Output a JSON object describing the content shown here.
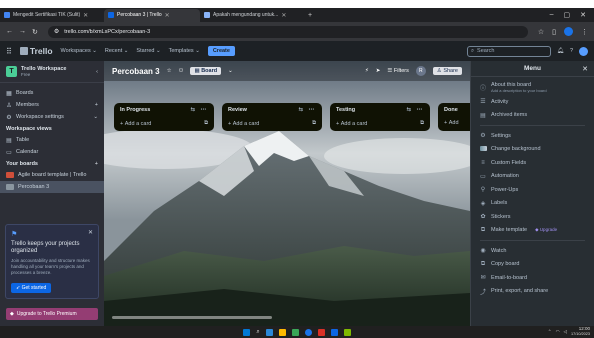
{
  "browser": {
    "tabs": [
      {
        "title": "Mengedit Sertifikasi TIK (Sulit)",
        "favicon_color": "#4285f4",
        "active": false
      },
      {
        "title": "Percobaan 3 | Trello",
        "favicon_color": "#0c66e4",
        "active": true
      },
      {
        "title": "Apakah mengundang untuk...",
        "favicon_color": "#8ab4f8",
        "active": false
      }
    ],
    "new_tab": "+",
    "window_controls": [
      "–",
      "▢",
      "✕"
    ],
    "url": "trello.com/b/xmLsPCx/percobaan-3"
  },
  "trello_header": {
    "logo_text": "Trello",
    "menus": [
      "Workspaces ⌄",
      "Recent ⌄",
      "Starred ⌄",
      "Templates ⌄"
    ],
    "create_label": "Create",
    "search_placeholder": "Search"
  },
  "sidebar": {
    "workspace_name": "Trello Workspace",
    "workspace_plan": "Free",
    "avatar_letter": "T",
    "items": [
      {
        "label": "Boards",
        "icon": "board-icon"
      },
      {
        "label": "Members",
        "icon": "members-icon",
        "add": "+"
      },
      {
        "label": "Workspace settings",
        "icon": "gear-icon",
        "add": "⌄"
      }
    ],
    "views_heading": "Workspace views",
    "views": [
      {
        "label": "Table",
        "icon": "table-icon"
      },
      {
        "label": "Calendar",
        "icon": "calendar-icon"
      }
    ],
    "boards_heading": "Your boards",
    "boards_add": "+",
    "boards": [
      {
        "label": "Agile board template | Trello",
        "color": "#d04f3a"
      },
      {
        "label": "Percobaan 3",
        "color": "#8a96a0"
      }
    ],
    "promo": {
      "title": "Trello keeps your projects organized",
      "body": "Join accountability and structure makes handling all your team's projects and processes a breeze.",
      "button": "Get started"
    },
    "upgrade_label": "Upgrade to Trello Premium"
  },
  "board": {
    "title": "Percobaan 3",
    "view_label": "Board",
    "filters_label": "Filters",
    "share_label": "Share",
    "member_initials": "R",
    "lists": [
      {
        "name": "In Progress",
        "add_label": "Add a card"
      },
      {
        "name": "Review",
        "add_label": "Add a card"
      },
      {
        "name": "Testing",
        "add_label": "Add a card"
      },
      {
        "name": "Done",
        "add_label": "Add"
      }
    ]
  },
  "menu": {
    "title": "Menu",
    "about_label": "About this board",
    "about_sub": "Add a description to your board",
    "items_top": [
      {
        "label": "Activity",
        "icon": "activity-icon"
      },
      {
        "label": "Archived items",
        "icon": "archive-icon"
      }
    ],
    "items_mid": [
      {
        "label": "Settings",
        "icon": "gear-icon"
      },
      {
        "label": "Change background",
        "icon": "background-icon"
      },
      {
        "label": "Custom Fields",
        "icon": "custom-fields-icon"
      },
      {
        "label": "Automation",
        "icon": "automation-icon"
      },
      {
        "label": "Power-Ups",
        "icon": "power-ups-icon"
      },
      {
        "label": "Labels",
        "icon": "label-icon"
      },
      {
        "label": "Stickers",
        "icon": "sticker-icon"
      }
    ],
    "make_template_label": "Make template",
    "upgrade_badge": "Upgrade",
    "items_bottom": [
      {
        "label": "Watch",
        "icon": "eye-icon"
      },
      {
        "label": "Copy board",
        "icon": "copy-icon"
      },
      {
        "label": "Email-to-board",
        "icon": "email-icon"
      },
      {
        "label": "Print, export, and share",
        "icon": "share-icon"
      }
    ]
  },
  "taskbar": {
    "time": "12:00",
    "date": "17/10/2023",
    "apps": [
      "#ffb900",
      "#0078d4",
      "#1a73e8",
      "#ffc83d",
      "#3aa757",
      "#0c66e4",
      "#d93025",
      "#2b88d8",
      "#7fba00"
    ]
  }
}
